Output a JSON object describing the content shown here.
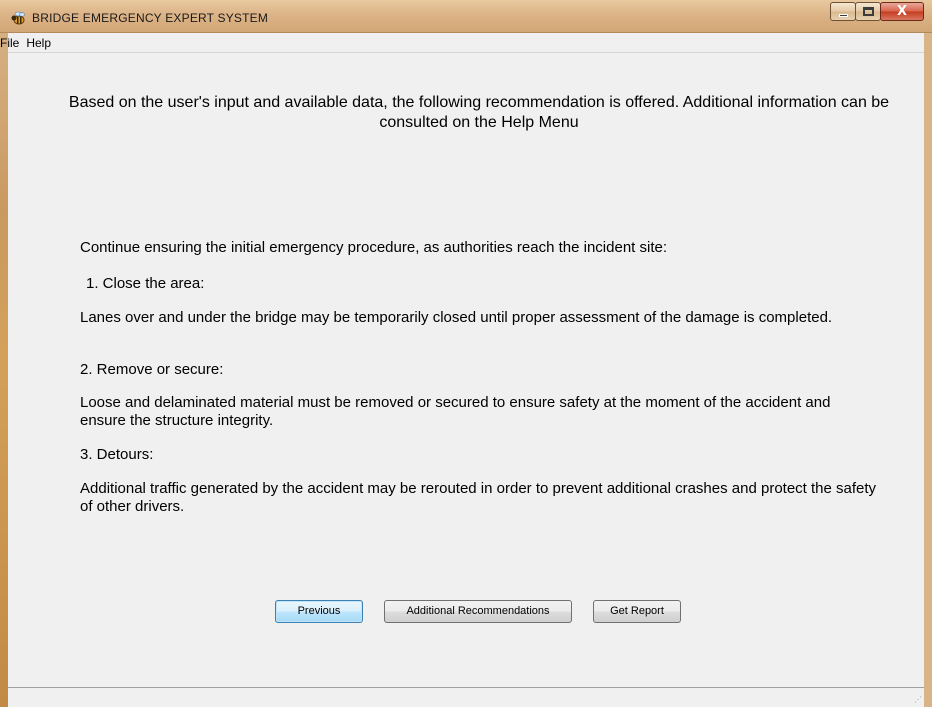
{
  "window": {
    "title": "BRIDGE EMERGENCY EXPERT SYSTEM",
    "app_icon": "bee-icon",
    "controls": {
      "minimize_icon": "minimize-icon",
      "maximize_icon": "maximize-icon",
      "close_icon": "close-icon",
      "close_glyph": "X"
    }
  },
  "menubar": {
    "items": [
      {
        "label": "File"
      },
      {
        "label": "Help"
      }
    ]
  },
  "content": {
    "intro": "Based on the user's input and available data, the following recommendation is offered. Additional information can be consulted on the Help Menu",
    "lead": "Continue ensuring the initial emergency procedure, as authorities reach the incident site:",
    "steps": [
      {
        "heading": "1.  Close the area:",
        "body": "Lanes over and under the bridge may be temporarily closed until proper assessment of the damage is completed."
      },
      {
        "heading": "2.  Remove or secure:",
        "body": "Loose and delaminated material must be removed or secured to ensure safety at the moment of the accident and ensure the structure integrity."
      },
      {
        "heading": "3.  Detours:",
        "body": "Additional traffic generated by the accident may be rerouted in order to prevent additional crashes and protect the safety of other drivers."
      }
    ]
  },
  "buttons": {
    "previous": "Previous",
    "additional": "Additional Recommendations",
    "report": "Get Report"
  },
  "colors": {
    "titlebar": "#dcb487",
    "client": "#f0f0f0",
    "focused_button": "#bee6fd"
  }
}
